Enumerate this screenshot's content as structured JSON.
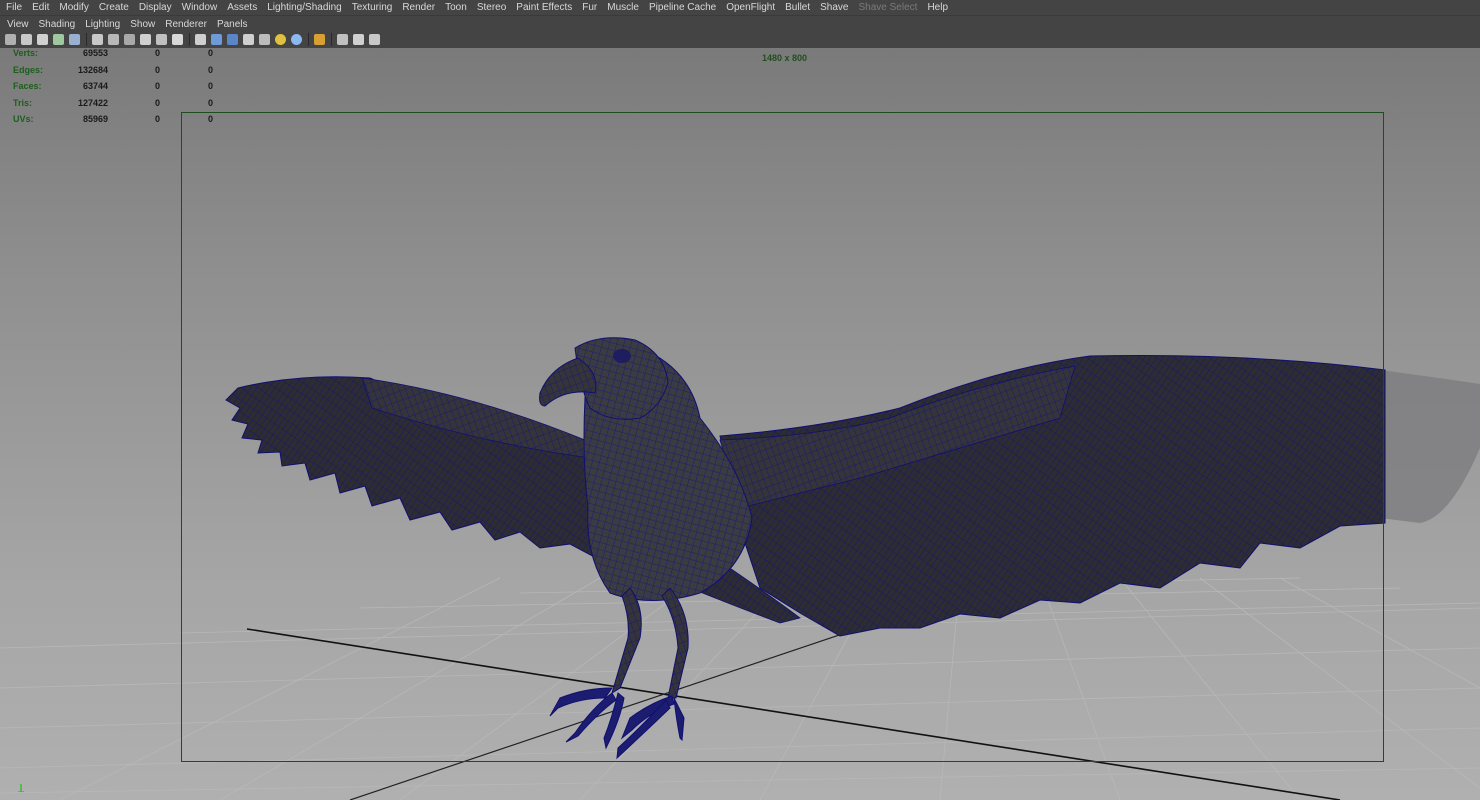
{
  "menubar": {
    "items": [
      "File",
      "Edit",
      "Modify",
      "Create",
      "Display",
      "Window",
      "Assets",
      "Lighting/Shading",
      "Texturing",
      "Render",
      "Toon",
      "Stereo",
      "Paint Effects",
      "Fur",
      "Muscle",
      "Pipeline Cache",
      "OpenFlight",
      "Bullet",
      "Shave",
      "Shave Select",
      "Help"
    ],
    "disabled": [
      "Shave Select"
    ]
  },
  "panel_menu": {
    "items": [
      "View",
      "Shading",
      "Lighting",
      "Show",
      "Renderer",
      "Panels"
    ]
  },
  "toolbar": {
    "icons": [
      "camera-select-icon",
      "camera-attributes-icon",
      "bookmark-icon",
      "image-plane-icon",
      "grid-toggle-icon",
      "film-gate-icon",
      "resolution-gate-icon",
      "gate-mask-icon",
      "field-chart-icon",
      "safe-action-icon",
      "safe-title-icon",
      "wireframe-icon",
      "smooth-shade-icon",
      "flat-shade-icon",
      "bounding-box-icon",
      "textured-icon",
      "default-light-icon",
      "shadows-icon",
      "isolate-select-icon",
      "xray-icon",
      "xray-joints-icon",
      "backface-icon"
    ]
  },
  "hud": {
    "rows": [
      {
        "label": "Verts:",
        "v1": "69553",
        "v2": "0",
        "v3": "0"
      },
      {
        "label": "Edges:",
        "v1": "132684",
        "v2": "0",
        "v3": "0"
      },
      {
        "label": "Faces:",
        "v1": "63744",
        "v2": "0",
        "v3": "0"
      },
      {
        "label": "Tris:",
        "v1": "127422",
        "v2": "0",
        "v3": "0"
      },
      {
        "label": "UVs:",
        "v1": "85969",
        "v2": "0",
        "v3": "0"
      }
    ],
    "resolution": "1480 x 800"
  },
  "colors": {
    "menu_bg": "#444444",
    "hud_label": "#1d5e1d",
    "gate": "#1e4d1e",
    "model_fill": "#3a3a40",
    "wire": "#1a1a8c"
  }
}
